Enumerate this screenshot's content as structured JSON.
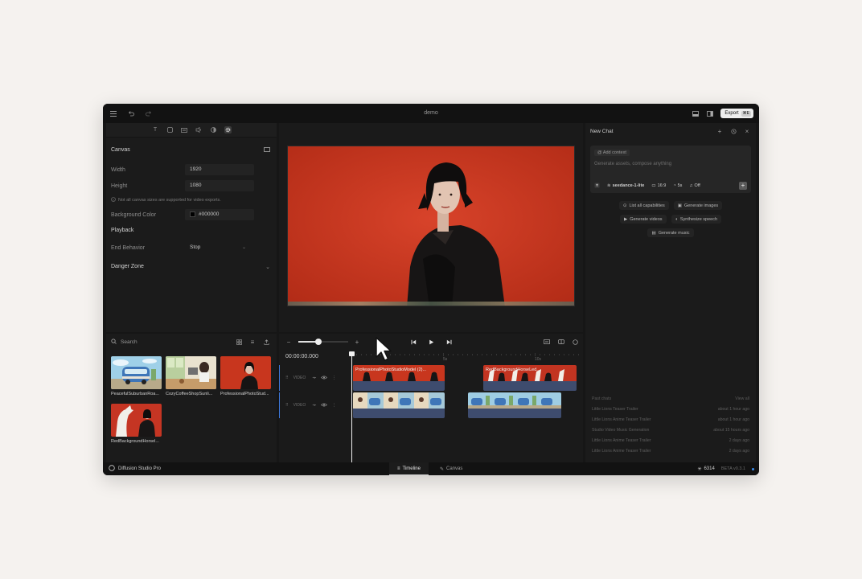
{
  "titlebar": {
    "title": "demo",
    "export_label": "Export",
    "export_shortcut": "⌘E"
  },
  "properties": {
    "canvas_title": "Canvas",
    "width_label": "Width",
    "width_value": "1920",
    "height_label": "Height",
    "height_value": "1080",
    "canvas_note": "Not all canvas sizes are supported for video exports.",
    "bg_label": "Background Color",
    "bg_value": "#000000",
    "playback_title": "Playback",
    "end_behavior_label": "End Behavior",
    "end_behavior_value": "Stop",
    "danger_zone_title": "Danger Zone"
  },
  "media": {
    "search_label": "Search",
    "items": [
      {
        "name": "PeacefulSuburbanRoa..."
      },
      {
        "name": "CozyCoffeeShopSunli..."
      },
      {
        "name": "ProfessionalPhotoStud..."
      },
      {
        "name": "RedBackgroundHorsel..."
      }
    ]
  },
  "timeline": {
    "timecode": "00:00:00.000",
    "zoom_level": 0.4,
    "ruler_labels": [
      "5s",
      "10s"
    ],
    "tracks": [
      {
        "label": "VIDEO",
        "clips": [
          {
            "label": "ProfessionalPhotoStudioModel (2)..."
          },
          {
            "label": "RedBackgroundHorseLed..."
          }
        ]
      },
      {
        "label": "VIDEO",
        "clips": [
          {
            "label": ""
          },
          {
            "label": ""
          }
        ]
      }
    ]
  },
  "chat": {
    "title": "New Chat",
    "add_context": "Add context",
    "placeholder": "Generate assets, compose anything",
    "model": "seedance-1-lite",
    "aspect": "16:9",
    "duration": "5s",
    "audio": "Off",
    "suggestions": [
      "List all capabilities",
      "Generate images",
      "Generate videos",
      "Synthesize speech",
      "Generate music"
    ],
    "past_title": "Past chats",
    "view_all": "View all",
    "past_chats": [
      {
        "name": "Little Lions Teaser Trailer",
        "time": "about 1 hour ago"
      },
      {
        "name": "Little Lions Anime Teaser Trailer",
        "time": "about 1 hour ago"
      },
      {
        "name": "Studio Video Music Generation",
        "time": "about 15 hours ago"
      },
      {
        "name": "Little Lions Anime Teaser Trailer",
        "time": "2 days ago"
      },
      {
        "name": "Little Lions Anime Teaser Trailer",
        "time": "2 days ago"
      }
    ]
  },
  "status": {
    "app_name": "Diffusion Studio Pro",
    "tab_timeline": "Timeline",
    "tab_canvas": "Canvas",
    "credits": "6314",
    "version": "BETA v0.3.1"
  },
  "colors": {
    "app_bg": "#161616",
    "panel_bg": "#1b1b1b",
    "video_bg": "#c9371f",
    "clip_underlay": "#3e4c6e",
    "track_accent": "#3d78d8"
  }
}
